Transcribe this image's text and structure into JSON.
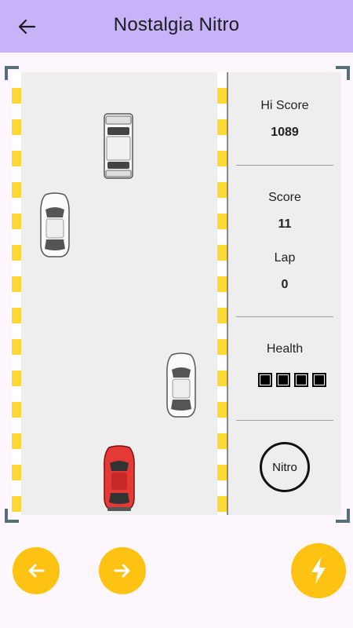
{
  "appbar": {
    "title": "Nostalgia Nitro",
    "back_icon": "arrow-back-icon"
  },
  "scoreboard": {
    "hi_score_label": "Hi Score",
    "hi_score": "1089",
    "score_label": "Score",
    "score": "11",
    "lap_label": "Lap",
    "lap": "0",
    "health_label": "Health",
    "health_blocks": 4,
    "nitro_label": "Nitro"
  },
  "controls": {
    "left_icon": "arrow-left-icon",
    "right_icon": "arrow-right-icon",
    "boost_icon": "lightning-bolt-icon"
  },
  "colors": {
    "appbar": "#c7b4f8",
    "accent": "#fec212",
    "player_car": "#e53935",
    "traffic_car": "#ffffff",
    "curb_stripe": "#fdd835"
  }
}
